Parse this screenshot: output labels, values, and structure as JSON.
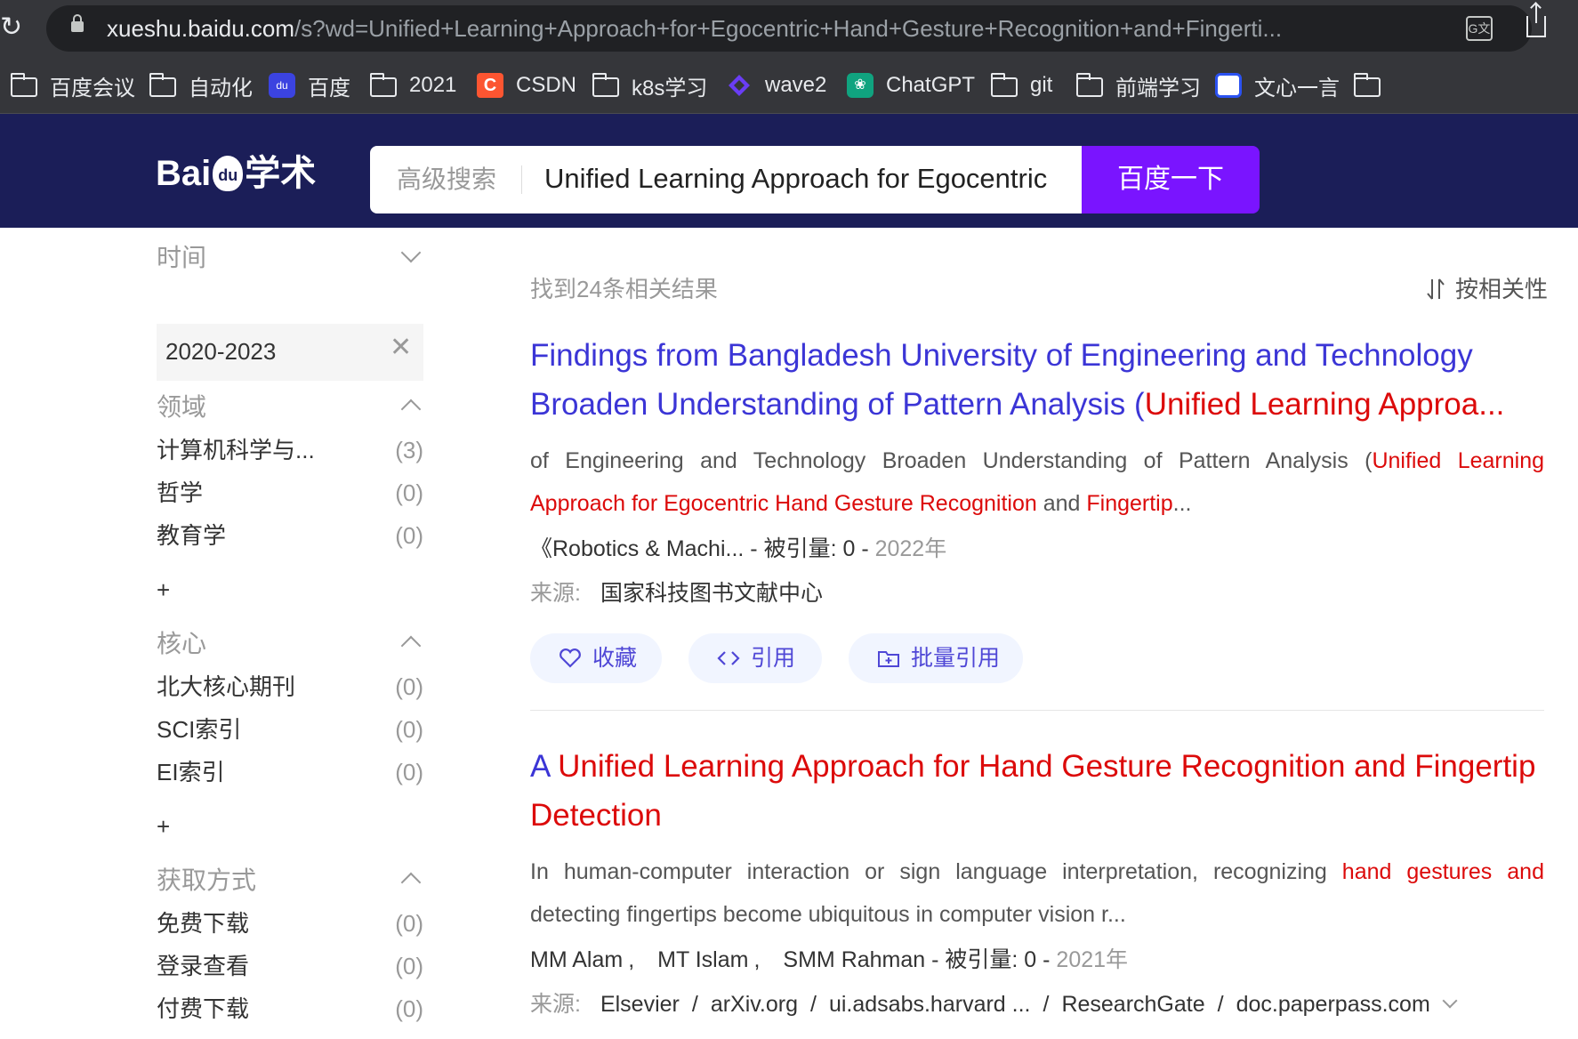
{
  "browser": {
    "url_host": "xueshu.baidu.com",
    "url_path": "/s?wd=Unified+Learning+Approach+for+Egocentric+Hand+Gesture+Recognition+and+Fingerti...",
    "bookmarks": [
      "百度会议",
      "自动化",
      "百度",
      "2021",
      "CSDN",
      "k8s学习",
      "wave2",
      "ChatGPT",
      "git",
      "前端学习",
      "文心一言"
    ]
  },
  "header": {
    "logo_text_1": "Bai",
    "logo_text_2": "学术",
    "advanced_search": "高级搜索",
    "query": "Unified Learning Approach for Egocentric",
    "search_button": "百度一下"
  },
  "sidebar": {
    "time": {
      "heading": "时间",
      "selected_range": "2020-2023"
    },
    "field": {
      "heading": "领域",
      "items": [
        {
          "label": "计算机科学与...",
          "count": "(3)"
        },
        {
          "label": "哲学",
          "count": "(0)"
        },
        {
          "label": "教育学",
          "count": "(0)"
        }
      ],
      "more": "+"
    },
    "core": {
      "heading": "核心",
      "items": [
        {
          "label": "北大核心期刊",
          "count": "(0)"
        },
        {
          "label": "SCI索引",
          "count": "(0)"
        },
        {
          "label": "EI索引",
          "count": "(0)"
        }
      ],
      "more": "+"
    },
    "access": {
      "heading": "获取方式",
      "items": [
        {
          "label": "免费下载",
          "count": "(0)"
        },
        {
          "label": "登录查看",
          "count": "(0)"
        },
        {
          "label": "付费下载",
          "count": "(0)"
        }
      ]
    }
  },
  "results": {
    "count_text": "找到24条相关结果",
    "sort_label": "按相关性",
    "items": [
      {
        "title_line1": "Findings from Bangladesh University of Engineering and Technology",
        "title_line2_plain": "Broaden Understanding of Pattern Analysis (",
        "title_line2_hl": "Unified Learning Approa...",
        "abstract_plain1": "of Engineering and Technology Broaden Understanding of Pattern Analysis (",
        "abstract_hl1": "Unified Learning",
        "abstract_hl2": "Approach for Egocentric Hand Gesture Recognition",
        "abstract_plain2": " and ",
        "abstract_hl3": "Fingertip",
        "abstract_plain3": "...",
        "journal": "《Robotics & Machi...",
        "sep": " - ",
        "cited": "被引量: 0",
        "year": "2022年",
        "source_label": "来源:",
        "sources": [
          "国家科技图书文献中心"
        ],
        "buttons": {
          "favorite": "收藏",
          "cite": "引用",
          "batch_cite": "批量引用"
        }
      },
      {
        "title_plain": "A ",
        "title_hl": "Unified Learning Approach for Hand Gesture Recognition and Fingertip Detection",
        "abstract_plain1": "In human-computer interaction or sign language interpretation, recognizing ",
        "abstract_hl1": "hand gestures and",
        "abstract_plain2": "detecting fingertips become ubiquitous in computer vision r...",
        "authors": [
          "MM Alam",
          "MT Islam",
          "SMM Rahman"
        ],
        "sep": " - ",
        "cited": "被引量: 0",
        "year": "2021年",
        "source_label": "来源:",
        "sources": [
          "Elsevier",
          "arXiv.org",
          "ui.adsabs.harvard ...",
          "ResearchGate",
          "doc.paperpass.com"
        ]
      }
    ]
  },
  "colors": {
    "header_bg": "#1b1e58",
    "search_button": "#7a14ff",
    "title_link": "#3b35d6",
    "highlight": "#dc0a0a",
    "chrome_bg": "#35363a"
  }
}
